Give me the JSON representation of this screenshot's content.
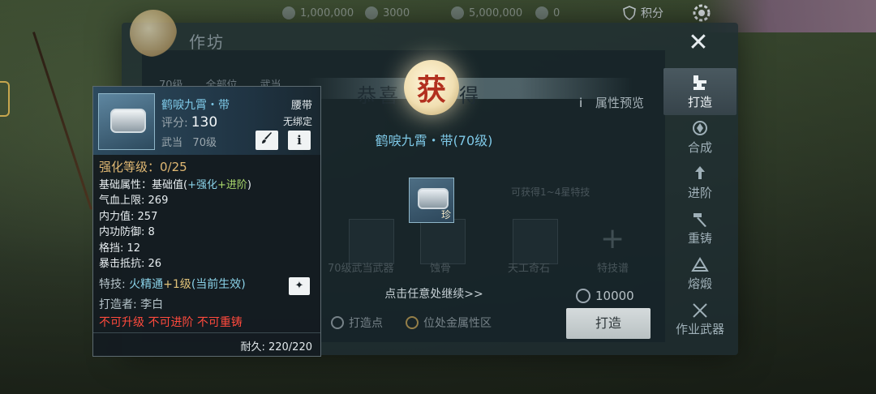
{
  "topbar": {
    "resources": [
      {
        "icon": "coin-icon",
        "value": "1,000,000"
      },
      {
        "icon": "boat-icon",
        "value": "3000"
      },
      {
        "icon": "hand-icon",
        "value": "5,000,000"
      },
      {
        "icon": "ingot-icon",
        "value": "0"
      }
    ],
    "points_label": "积分",
    "points_icon": "shield-icon",
    "settings_icon": "gear-icon"
  },
  "panel": {
    "title": "作坊",
    "close_icon": "close-icon",
    "filters": [
      "70级",
      "全部位",
      "武当"
    ]
  },
  "sidenav": [
    {
      "label": "打造",
      "icon": "anvil-icon",
      "active": true
    },
    {
      "label": "合成",
      "icon": "merge-icon",
      "active": false
    },
    {
      "label": "进阶",
      "icon": "upgrade-icon",
      "active": false
    },
    {
      "label": "重铸",
      "icon": "hammer-icon",
      "active": false
    },
    {
      "label": "熔煅",
      "icon": "smelt-icon",
      "active": false
    },
    {
      "label": "作业武器",
      "icon": "weapon-icon",
      "active": false
    }
  ],
  "congrats": {
    "left_text": "恭喜",
    "center_char": "获",
    "right_text": "得",
    "item_name": "鹤唳九霄・带(70级)",
    "item_rank": "珍",
    "continue_text": "点击任意处继续>>"
  },
  "craft": {
    "attr_preview_label": "属性预览",
    "slot_labels": [
      "70级武当武器",
      "蚀骨",
      "天工奇石",
      "特技谱"
    ],
    "hint_text": "可获得1~4星特技",
    "cost_value": "10000",
    "forge_button": "打造",
    "bottom_items": [
      {
        "icon": "search-icon",
        "label": "打造点"
      },
      {
        "icon": "gold-coin-icon",
        "label": "位处金属性区"
      }
    ]
  },
  "tooltip": {
    "name": "鹤唳九霄・带",
    "slot": "腰带",
    "bind": "无绑定",
    "score_label": "评分:",
    "score": "130",
    "school": "武当",
    "level": "70级",
    "brush_icon": "brush-icon",
    "info_icon": "info-icon",
    "enhance": "强化等级：0/25",
    "base_prefix": "基础属性：基础值(",
    "base_enh": "+强化",
    "base_adv": "+进阶",
    "base_suffix": ")",
    "stats": [
      {
        "name": "气血上限:",
        "value": "269"
      },
      {
        "name": "内力值:",
        "value": "257"
      },
      {
        "name": "内功防御:",
        "value": "8"
      },
      {
        "name": "格挡:",
        "value": "12"
      },
      {
        "name": "暴击抵抗:",
        "value": "26"
      }
    ],
    "skill_label": "特技:",
    "skill_name": "火精通",
    "skill_level": "+1级",
    "skill_effect": "(当前生效)",
    "skill_icon": "flame-icon",
    "maker_label": "打造者:",
    "maker": "李白",
    "warning": "不可升级 不可进阶 不可重铸",
    "durability_label": "耐久:",
    "durability": "220/220"
  }
}
